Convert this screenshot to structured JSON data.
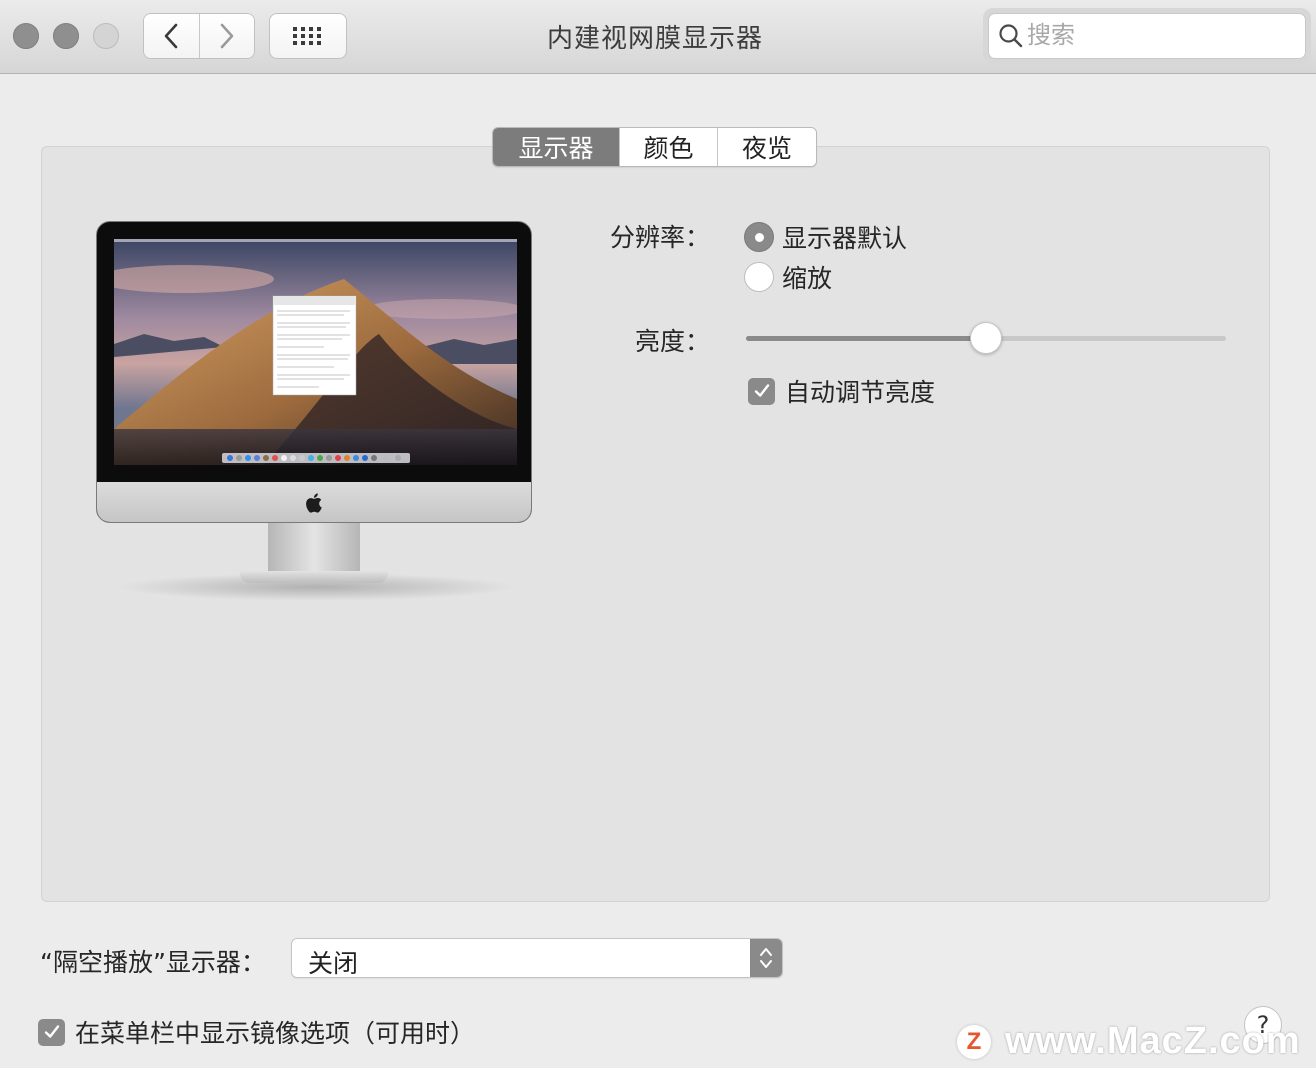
{
  "window": {
    "title": "内建视网膜显示器"
  },
  "toolbar": {
    "back_icon": "chevron-left-icon",
    "forward_icon": "chevron-right-icon",
    "grid_icon": "grid-icon",
    "search_placeholder": "搜索"
  },
  "tabs": [
    {
      "label": "显示器",
      "active": true
    },
    {
      "label": "颜色",
      "active": false
    },
    {
      "label": "夜览",
      "active": false
    }
  ],
  "display": {
    "resolution_label": "分辨率：",
    "resolution_options": [
      {
        "label": "显示器默认",
        "selected": true
      },
      {
        "label": "缩放",
        "selected": false
      }
    ],
    "brightness_label": "亮度：",
    "brightness_level": 0.5,
    "auto_brightness_label": "自动调节亮度",
    "auto_brightness_checked": true
  },
  "airplay": {
    "label": "“隔空播放”显示器：",
    "value": "关闭"
  },
  "mirroring": {
    "label": "在菜单栏中显示镜像选项（可用时）",
    "checked": true
  },
  "help": {
    "label": "?"
  },
  "watermark": {
    "logo": "Z",
    "text": "www.MacZ.com"
  },
  "colors": {
    "accent_gray": "#8a8a8a",
    "active_tab": "#7c7c7c",
    "watermark_logo": "#e8542c"
  }
}
